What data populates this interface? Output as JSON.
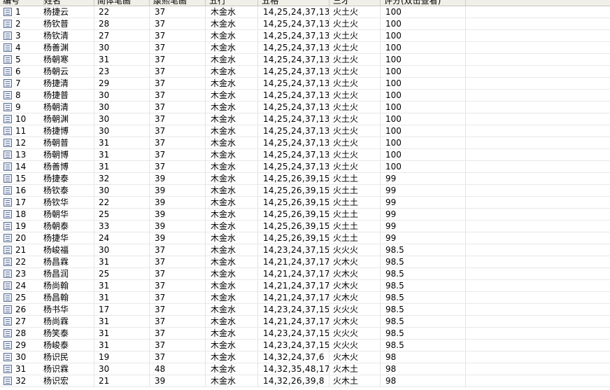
{
  "header": {
    "col_num": "编号",
    "col_name": "姓名",
    "col_jianti": "简体笔画",
    "col_kangxi": "康熙笔画",
    "col_wuxing": "五行",
    "col_wuge": "五格",
    "col_sancai": "三才",
    "col_score": "评分(双击查看)"
  },
  "rows": [
    {
      "num": "1",
      "name": "杨捷云",
      "jt": "22",
      "kx": "37",
      "wx": "木金水",
      "wg": "14,25,24,37,13",
      "sc": "火土火",
      "pf": "100"
    },
    {
      "num": "2",
      "name": "杨钦普",
      "jt": "28",
      "kx": "37",
      "wx": "木金水",
      "wg": "14,25,24,37,13",
      "sc": "火土火",
      "pf": "100"
    },
    {
      "num": "3",
      "name": "杨钦清",
      "jt": "27",
      "kx": "37",
      "wx": "木金水",
      "wg": "14,25,24,37,13",
      "sc": "火土火",
      "pf": "100"
    },
    {
      "num": "4",
      "name": "杨善渊",
      "jt": "30",
      "kx": "37",
      "wx": "木金水",
      "wg": "14,25,24,37,13",
      "sc": "火土火",
      "pf": "100"
    },
    {
      "num": "5",
      "name": "杨朝寒",
      "jt": "31",
      "kx": "37",
      "wx": "木金水",
      "wg": "14,25,24,37,13",
      "sc": "火土火",
      "pf": "100"
    },
    {
      "num": "6",
      "name": "杨朝云",
      "jt": "23",
      "kx": "37",
      "wx": "木金水",
      "wg": "14,25,24,37,13",
      "sc": "火土火",
      "pf": "100"
    },
    {
      "num": "7",
      "name": "杨捷清",
      "jt": "29",
      "kx": "37",
      "wx": "木金水",
      "wg": "14,25,24,37,13",
      "sc": "火土火",
      "pf": "100"
    },
    {
      "num": "8",
      "name": "杨捷普",
      "jt": "30",
      "kx": "37",
      "wx": "木金水",
      "wg": "14,25,24,37,13",
      "sc": "火土火",
      "pf": "100"
    },
    {
      "num": "9",
      "name": "杨朝清",
      "jt": "30",
      "kx": "37",
      "wx": "木金水",
      "wg": "14,25,24,37,13",
      "sc": "火土火",
      "pf": "100"
    },
    {
      "num": "10",
      "name": "杨朝渊",
      "jt": "30",
      "kx": "37",
      "wx": "木金水",
      "wg": "14,25,24,37,13",
      "sc": "火土火",
      "pf": "100"
    },
    {
      "num": "11",
      "name": "杨捷博",
      "jt": "30",
      "kx": "37",
      "wx": "木金水",
      "wg": "14,25,24,37,13",
      "sc": "火土火",
      "pf": "100"
    },
    {
      "num": "12",
      "name": "杨朝普",
      "jt": "31",
      "kx": "37",
      "wx": "木金水",
      "wg": "14,25,24,37,13",
      "sc": "火土火",
      "pf": "100"
    },
    {
      "num": "13",
      "name": "杨朝博",
      "jt": "31",
      "kx": "37",
      "wx": "木金水",
      "wg": "14,25,24,37,13",
      "sc": "火土火",
      "pf": "100"
    },
    {
      "num": "14",
      "name": "杨善博",
      "jt": "31",
      "kx": "37",
      "wx": "木金水",
      "wg": "14,25,24,37,13",
      "sc": "火土火",
      "pf": "100"
    },
    {
      "num": "15",
      "name": "杨捷泰",
      "jt": "32",
      "kx": "39",
      "wx": "木金水",
      "wg": "14,25,26,39,15",
      "sc": "火土土",
      "pf": "99"
    },
    {
      "num": "16",
      "name": "杨钦泰",
      "jt": "30",
      "kx": "39",
      "wx": "木金水",
      "wg": "14,25,26,39,15",
      "sc": "火土土",
      "pf": "99"
    },
    {
      "num": "17",
      "name": "杨钦华",
      "jt": "22",
      "kx": "39",
      "wx": "木金水",
      "wg": "14,25,26,39,15",
      "sc": "火土土",
      "pf": "99"
    },
    {
      "num": "18",
      "name": "杨朝华",
      "jt": "25",
      "kx": "39",
      "wx": "木金水",
      "wg": "14,25,26,39,15",
      "sc": "火土土",
      "pf": "99"
    },
    {
      "num": "19",
      "name": "杨朝泰",
      "jt": "33",
      "kx": "39",
      "wx": "木金水",
      "wg": "14,25,26,39,15",
      "sc": "火土土",
      "pf": "99"
    },
    {
      "num": "20",
      "name": "杨捷华",
      "jt": "24",
      "kx": "39",
      "wx": "木金水",
      "wg": "14,25,26,39,15",
      "sc": "火土土",
      "pf": "99"
    },
    {
      "num": "21",
      "name": "杨峻福",
      "jt": "30",
      "kx": "37",
      "wx": "木金水",
      "wg": "14,23,24,37,15",
      "sc": "火火火",
      "pf": "98.5"
    },
    {
      "num": "22",
      "name": "杨昌霖",
      "jt": "31",
      "kx": "37",
      "wx": "木金水",
      "wg": "14,21,24,37,17",
      "sc": "火木火",
      "pf": "98.5"
    },
    {
      "num": "23",
      "name": "杨昌润",
      "jt": "25",
      "kx": "37",
      "wx": "木金水",
      "wg": "14,21,24,37,17",
      "sc": "火木火",
      "pf": "98.5"
    },
    {
      "num": "24",
      "name": "杨尚翰",
      "jt": "31",
      "kx": "37",
      "wx": "木金水",
      "wg": "14,21,24,37,17",
      "sc": "火木火",
      "pf": "98.5"
    },
    {
      "num": "25",
      "name": "杨昌翰",
      "jt": "31",
      "kx": "37",
      "wx": "木金水",
      "wg": "14,21,24,37,17",
      "sc": "火木火",
      "pf": "98.5"
    },
    {
      "num": "26",
      "name": "杨书华",
      "jt": "17",
      "kx": "37",
      "wx": "木金水",
      "wg": "14,23,24,37,15",
      "sc": "火火火",
      "pf": "98.5"
    },
    {
      "num": "27",
      "name": "杨尚霖",
      "jt": "31",
      "kx": "37",
      "wx": "木金水",
      "wg": "14,21,24,37,17",
      "sc": "火木火",
      "pf": "98.5"
    },
    {
      "num": "28",
      "name": "杨笑泰",
      "jt": "31",
      "kx": "37",
      "wx": "木金水",
      "wg": "14,23,24,37,15",
      "sc": "火火火",
      "pf": "98.5"
    },
    {
      "num": "29",
      "name": "杨峻泰",
      "jt": "31",
      "kx": "37",
      "wx": "木金水",
      "wg": "14,23,24,37,15",
      "sc": "火火火",
      "pf": "98.5"
    },
    {
      "num": "30",
      "name": "杨识民",
      "jt": "19",
      "kx": "37",
      "wx": "木金水",
      "wg": "14,32,24,37,6",
      "sc": "火木火",
      "pf": "98"
    },
    {
      "num": "31",
      "name": "杨识霖",
      "jt": "30",
      "kx": "48",
      "wx": "木金水",
      "wg": "14,32,35,48,17",
      "sc": "火木土",
      "pf": "98"
    },
    {
      "num": "32",
      "name": "杨识宏",
      "jt": "21",
      "kx": "39",
      "wx": "木金水",
      "wg": "14,32,26,39,8",
      "sc": "火木土",
      "pf": "98"
    }
  ]
}
